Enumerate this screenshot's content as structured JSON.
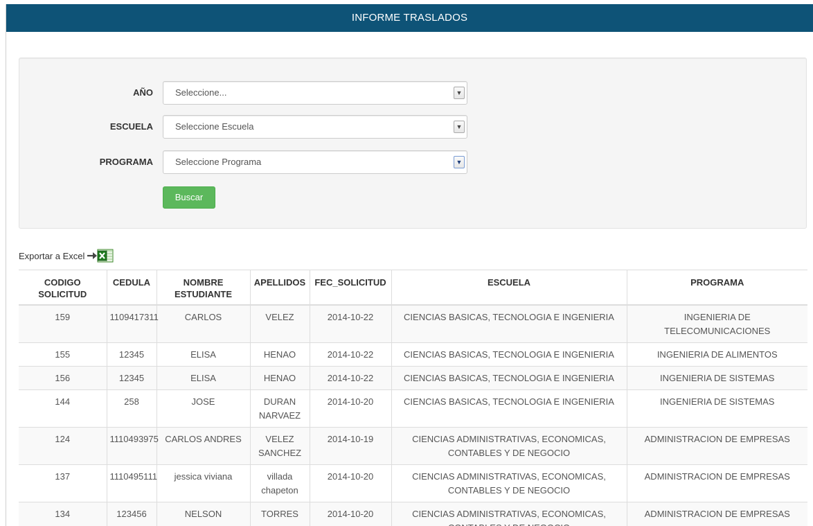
{
  "colors": {
    "header_bg": "#0e5377",
    "button_bg": "#5cb85c",
    "panel_bg": "#f5f5f5"
  },
  "header": {
    "title": "INFORME TRASLADOS"
  },
  "filters": {
    "year": {
      "label": "AÑO",
      "value": "Seleccione..."
    },
    "school": {
      "label": "ESCUELA",
      "value": "Seleccione Escuela"
    },
    "program": {
      "label": "PROGRAMA",
      "value": "Seleccione Programa"
    },
    "search_button": "Buscar"
  },
  "export": {
    "label": "Exportar a Excel",
    "icon": "excel-icon"
  },
  "table": {
    "columns": [
      "CODIGO SOLICITUD",
      "CEDULA",
      "NOMBRE ESTUDIANTE",
      "APELLIDOS",
      "FEC_SOLICITUD",
      "ESCUELA",
      "PROGRAMA"
    ],
    "rows": [
      [
        "159",
        "1109417311",
        "CARLOS",
        "VELEZ",
        "2014-10-22",
        "CIENCIAS BASICAS, TECNOLOGIA E INGENIERIA",
        "INGENIERIA DE TELECOMUNICACIONES"
      ],
      [
        "155",
        "12345",
        "ELISA",
        "HENAO",
        "2014-10-22",
        "CIENCIAS BASICAS, TECNOLOGIA E INGENIERIA",
        "INGENIERIA DE ALIMENTOS"
      ],
      [
        "156",
        "12345",
        "ELISA",
        "HENAO",
        "2014-10-22",
        "CIENCIAS BASICAS, TECNOLOGIA E INGENIERIA",
        "INGENIERIA DE SISTEMAS"
      ],
      [
        "144",
        "258",
        "JOSE",
        "DURAN NARVAEZ",
        "2014-10-20",
        "CIENCIAS BASICAS, TECNOLOGIA E INGENIERIA",
        "INGENIERIA DE SISTEMAS"
      ],
      [
        "124",
        "1110493975",
        "CARLOS ANDRES",
        "VELEZ SANCHEZ",
        "2014-10-19",
        "CIENCIAS ADMINISTRATIVAS, ECONOMICAS, CONTABLES Y DE NEGOCIO",
        "ADMINISTRACION DE EMPRESAS"
      ],
      [
        "137",
        "1110495111",
        "jessica viviana",
        "villada chapeton",
        "2014-10-20",
        "CIENCIAS ADMINISTRATIVAS, ECONOMICAS, CONTABLES Y DE NEGOCIO",
        "ADMINISTRACION DE EMPRESAS"
      ],
      [
        "134",
        "123456",
        "NELSON",
        "TORRES",
        "2014-10-20",
        "CIENCIAS ADMINISTRATIVAS, ECONOMICAS, CONTABLES Y DE NEGOCIO",
        "ADMINISTRACION DE EMPRESAS"
      ]
    ]
  }
}
